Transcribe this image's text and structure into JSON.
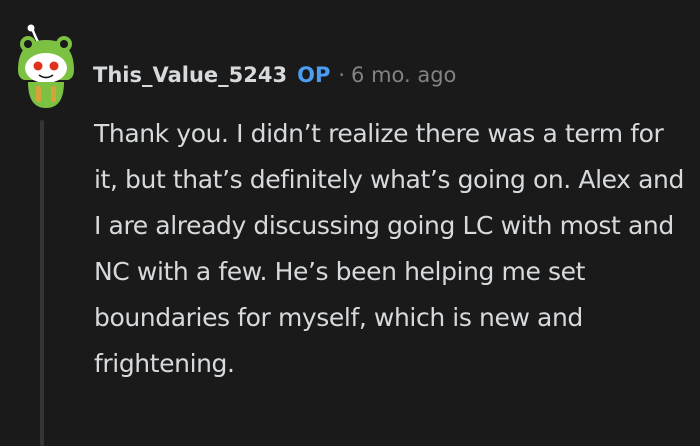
{
  "comment": {
    "author": "This_Value_5243",
    "op_label": "OP",
    "separator": "·",
    "timestamp": "6 mo. ago",
    "body": "Thank you. I didn’t realize there was a term for it, but that’s definitely what’s going on. Alex and I are already discussing going LC with most and NC with a few. He’s been helping me set boundaries for myself, which is new and frightening."
  },
  "colors": {
    "background": "#1a1a1b",
    "text": "#d7dadc",
    "op_badge": "#4a9df0",
    "muted": "#818384",
    "thread_line": "#343536"
  },
  "icons": {
    "avatar": "snoo-avatar-frog-hat-icon"
  }
}
